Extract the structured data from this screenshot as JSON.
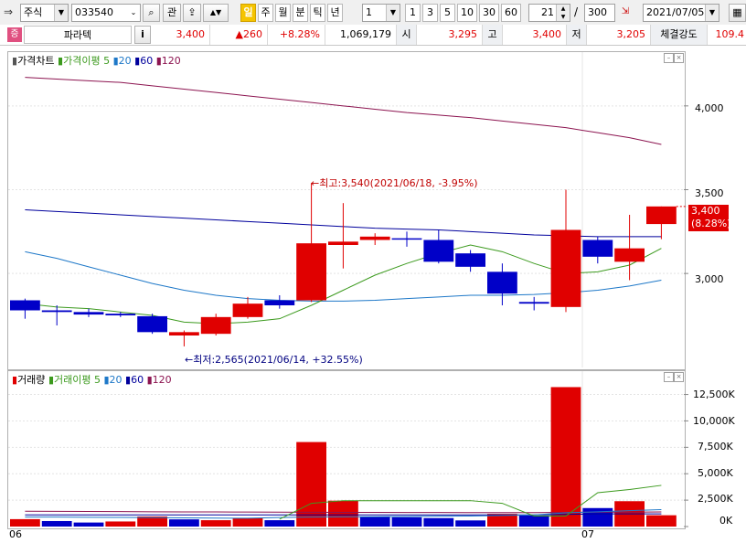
{
  "toolbar": {
    "market_type": "주식",
    "stock_code": "033540",
    "favorite_label": "관",
    "periods": [
      "일",
      "주",
      "월",
      "분",
      "틱",
      "년"
    ],
    "active_period": "일",
    "minute_value": "1",
    "intervals": [
      "1",
      "3",
      "5",
      "10",
      "30",
      "60"
    ],
    "display_count": "21",
    "total_count": "300",
    "count_separator": "/",
    "date": "2021/07/05"
  },
  "info": {
    "market_badge": "증",
    "stock_name": "파라텍",
    "info_button": "i",
    "price": "3,400",
    "change": "▲260",
    "change_pct": "+8.28%",
    "volume": "1,069,179",
    "open_label": "시",
    "open": "3,295",
    "high_label": "고",
    "high": "3,400",
    "low_label": "저",
    "low": "3,205",
    "strength_label": "체결강도",
    "strength": "109.4"
  },
  "price_panel": {
    "title": "가격차트",
    "ma_label": "가격이평",
    "ma_periods": [
      "5",
      "20",
      "60",
      "120"
    ],
    "y_ticks": [
      "4,000",
      "3,500",
      "3,000"
    ],
    "current_price": "3,400",
    "current_pct": "(8.28%)",
    "high_annotation": "←최고:3,540(2021/06/18, -3.95%)",
    "low_annotation": "←최저:2,565(2021/06/14, +32.55%)"
  },
  "volume_panel": {
    "title": "거래량",
    "ma_label": "거래이평",
    "ma_periods": [
      "5",
      "20",
      "60",
      "120"
    ],
    "y_ticks": [
      "12,500K",
      "10,000K",
      "7,500K",
      "5,000K",
      "2,500K",
      "0K"
    ]
  },
  "x_axis": {
    "labels": [
      "06",
      "07"
    ]
  },
  "colors": {
    "up": "#e00000",
    "down": "#0000c8",
    "ma5": "#3c9a1e",
    "ma20": "#1e78c8",
    "ma60": "#00009c",
    "ma120": "#8c1450"
  },
  "chart_data": [
    {
      "type": "candlestick",
      "title": "가격차트",
      "ylim": [
        2450,
        4250
      ],
      "candles": [
        {
          "o": 2840,
          "h": 2850,
          "l": 2730,
          "c": 2780
        },
        {
          "o": 2780,
          "h": 2810,
          "l": 2690,
          "c": 2770
        },
        {
          "o": 2770,
          "h": 2790,
          "l": 2740,
          "c": 2755
        },
        {
          "o": 2760,
          "h": 2770,
          "l": 2740,
          "c": 2750
        },
        {
          "o": 2745,
          "h": 2760,
          "l": 2640,
          "c": 2650
        },
        {
          "o": 2630,
          "h": 2660,
          "l": 2565,
          "c": 2650
        },
        {
          "o": 2640,
          "h": 2760,
          "l": 2630,
          "c": 2740
        },
        {
          "o": 2740,
          "h": 2860,
          "l": 2730,
          "c": 2820
        },
        {
          "o": 2840,
          "h": 2870,
          "l": 2790,
          "c": 2810
        },
        {
          "o": 2840,
          "h": 3540,
          "l": 2830,
          "c": 3180
        },
        {
          "o": 3170,
          "h": 3420,
          "l": 3030,
          "c": 3190
        },
        {
          "o": 3200,
          "h": 3240,
          "l": 3170,
          "c": 3220
        },
        {
          "o": 3210,
          "h": 3250,
          "l": 3160,
          "c": 3205
        },
        {
          "o": 3200,
          "h": 3260,
          "l": 3060,
          "c": 3070
        },
        {
          "o": 3120,
          "h": 3140,
          "l": 3010,
          "c": 3040
        },
        {
          "o": 3010,
          "h": 3060,
          "l": 2810,
          "c": 2880
        },
        {
          "o": 2830,
          "h": 2860,
          "l": 2780,
          "c": 2820
        },
        {
          "o": 2800,
          "h": 3500,
          "l": 2770,
          "c": 3260
        },
        {
          "o": 3200,
          "h": 3220,
          "l": 3060,
          "c": 3100
        },
        {
          "o": 3070,
          "h": 3350,
          "l": 2960,
          "c": 3150
        },
        {
          "o": 3295,
          "h": 3400,
          "l": 3205,
          "c": 3400
        }
      ],
      "ma5": [
        2820,
        2800,
        2790,
        2770,
        2750,
        2710,
        2700,
        2710,
        2730,
        2810,
        2900,
        2990,
        3060,
        3120,
        3170,
        3130,
        3060,
        3000,
        3010,
        3050,
        3150
      ],
      "ma20": [
        3130,
        3090,
        3040,
        2990,
        2940,
        2900,
        2870,
        2850,
        2840,
        2835,
        2835,
        2840,
        2850,
        2860,
        2870,
        2870,
        2875,
        2885,
        2900,
        2925,
        2960
      ],
      "ma60": [
        3380,
        3370,
        3360,
        3350,
        3340,
        3330,
        3320,
        3310,
        3300,
        3290,
        3280,
        3270,
        3265,
        3260,
        3250,
        3240,
        3230,
        3225,
        3220,
        3220,
        3220
      ],
      "ma120": [
        4170,
        4160,
        4150,
        4140,
        4120,
        4100,
        4080,
        4060,
        4040,
        4020,
        4000,
        3980,
        3960,
        3945,
        3930,
        3910,
        3890,
        3870,
        3840,
        3810,
        3770
      ]
    },
    {
      "type": "bar",
      "title": "거래량",
      "ylim": [
        0,
        13500
      ],
      "values": [
        700,
        520,
        380,
        480,
        950,
        680,
        600,
        780,
        600,
        8000,
        2450,
        950,
        880,
        800,
        580,
        1200,
        1050,
        13200,
        1750,
        2400,
        1069
      ],
      "up": [
        true,
        false,
        false,
        true,
        true,
        false,
        true,
        true,
        false,
        true,
        true,
        false,
        false,
        false,
        false,
        true,
        false,
        true,
        false,
        true,
        true
      ],
      "ma5": [
        0,
        0,
        0,
        0,
        0,
        0,
        0,
        0,
        700,
        2200,
        2450,
        2450,
        2450,
        2450,
        2450,
        2200,
        1000,
        1000,
        3200,
        3500,
        3900
      ],
      "ma20": [
        900,
        900,
        880,
        860,
        840,
        820,
        800,
        790,
        850,
        900,
        920,
        930,
        950,
        980,
        1000,
        1050,
        1100,
        1300,
        1400,
        1500,
        1600
      ],
      "ma60": [
        1100,
        1100,
        1100,
        1100,
        1100,
        1100,
        1100,
        1100,
        1100,
        1100,
        1100,
        1100,
        1100,
        1100,
        1100,
        1100,
        1100,
        1150,
        1200,
        1200,
        1200
      ],
      "ma120": [
        1450,
        1440,
        1430,
        1420,
        1400,
        1390,
        1380,
        1370,
        1360,
        1350,
        1340,
        1340,
        1330,
        1330,
        1320,
        1320,
        1320,
        1340,
        1360,
        1360,
        1380
      ]
    }
  ]
}
